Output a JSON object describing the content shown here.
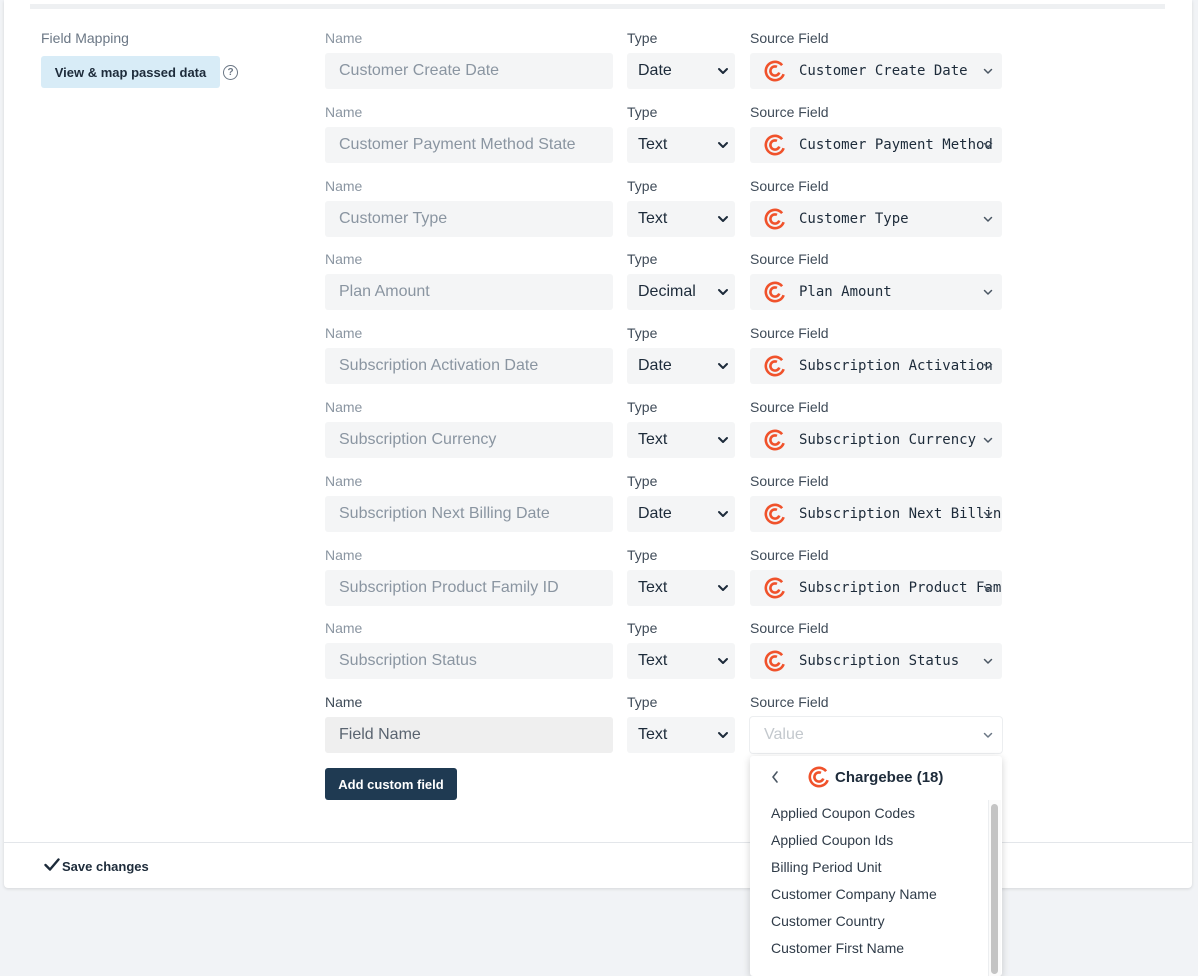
{
  "field_mapping": {
    "label": "Field Mapping",
    "view_button": "View & map passed data",
    "help_glyph": "?"
  },
  "column_labels": {
    "name": "Name",
    "type": "Type",
    "source": "Source Field"
  },
  "rows": [
    {
      "name": "Customer Create Date",
      "type": "Date",
      "source": "Customer Create Date"
    },
    {
      "name": "Customer Payment Method State",
      "type": "Text",
      "source": "Customer Payment Method St"
    },
    {
      "name": "Customer Type",
      "type": "Text",
      "source": "Customer Type"
    },
    {
      "name": "Plan Amount",
      "type": "Decimal",
      "source": "Plan Amount"
    },
    {
      "name": "Subscription Activation Date",
      "type": "Date",
      "source": "Subscription Activation Da"
    },
    {
      "name": "Subscription Currency",
      "type": "Text",
      "source": "Subscription Currency"
    },
    {
      "name": "Subscription Next Billing Date",
      "type": "Date",
      "source": "Subscription Next Billing"
    },
    {
      "name": "Subscription Product Family ID",
      "type": "Text",
      "source": "Subscription Product Famil"
    },
    {
      "name": "Subscription Status",
      "type": "Text",
      "source": "Subscription Status"
    }
  ],
  "new_row": {
    "name_placeholder": "Field Name",
    "type": "Text",
    "source_placeholder": "Value"
  },
  "add_custom_field": "Add custom field",
  "save_changes": "Save changes",
  "dropdown": {
    "title": "Chargebee (18)",
    "items": [
      "Applied Coupon Codes",
      "Applied Coupon Ids",
      "Billing Period Unit",
      "Customer Company Name",
      "Customer Country",
      "Customer First Name"
    ]
  },
  "icons": {
    "source_logo": "chargebee-logo-icon",
    "select_arrow": "chevron-down-icon",
    "back": "chevron-left-icon",
    "save": "checkmark-icon",
    "help": "question-circle-icon"
  },
  "colors": {
    "brand_orange": "#f0522b",
    "primary_button": "#1f3a52",
    "view_button_bg": "#d8ecf7"
  }
}
